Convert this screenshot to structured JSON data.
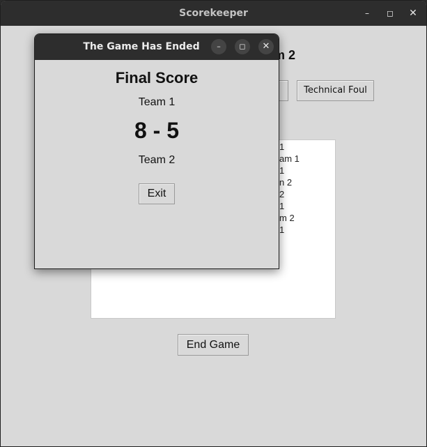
{
  "main_window": {
    "title": "Scorekeeper",
    "controls": {
      "minimize": "–",
      "maximize": "◻",
      "close": "✕"
    },
    "heading_partial": "m 2",
    "button_partial_label": "",
    "technical_foul_label": "Technical Foul",
    "log_lines": [
      "1",
      "am 1",
      "1",
      "n 2",
      "2",
      "1",
      "m 2",
      "1"
    ],
    "end_game_label": "End Game"
  },
  "dialog": {
    "title": "The Game Has Ended",
    "controls": {
      "minimize": "–",
      "maximize": "◻",
      "close": "✕"
    },
    "final_score_heading": "Final Score",
    "team1_label": "Team 1",
    "score_text": "8 - 5",
    "team2_label": "Team 2",
    "exit_label": "Exit"
  }
}
